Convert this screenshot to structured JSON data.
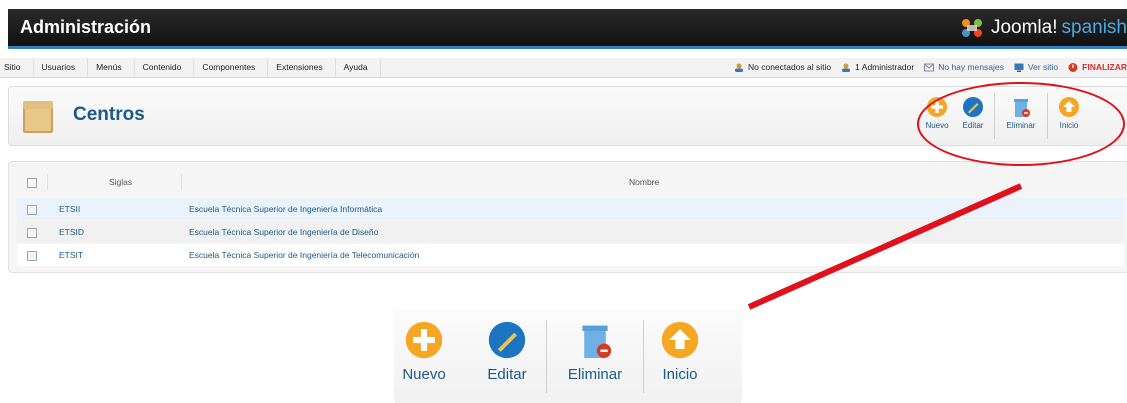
{
  "header": {
    "title": "Administración",
    "brand": "Joomla!",
    "brand_accent": "spanish"
  },
  "menu": {
    "items": [
      "Sitio",
      "Usuarios",
      "Menús",
      "Contenido",
      "Componentes",
      "Extensiones",
      "Ayuda"
    ]
  },
  "status": {
    "visitors": "No conectados al sitio",
    "admins": "1 Administrador",
    "messages": "No hay mensajes",
    "view_site": "Ver sitio",
    "logout": "FINALIZAR"
  },
  "toolbar": {
    "title": "Centros",
    "buttons": [
      "Nuevo",
      "Editar",
      "Eliminar",
      "Inicio"
    ]
  },
  "table": {
    "headers": {
      "siglas": "Siglas",
      "nombre": "Nombre"
    },
    "rows": [
      {
        "siglas": "ETSII",
        "nombre": "Escuela Técnica Superior de Ingeniería Informática"
      },
      {
        "siglas": "ETSID",
        "nombre": "Escuela Técnica Superior de Ingeniería de Diseño"
      },
      {
        "siglas": "ETSIT",
        "nombre": "Escuela Técnica Superior de Ingeniería de Telecomunicación"
      }
    ]
  },
  "zoom": {
    "buttons": [
      "Nuevo",
      "Editar",
      "Eliminar",
      "Inicio"
    ]
  },
  "colors": {
    "annotation": "#e0111a",
    "accent": "#1a5a8a",
    "header_bar": "#2f7fc2"
  }
}
